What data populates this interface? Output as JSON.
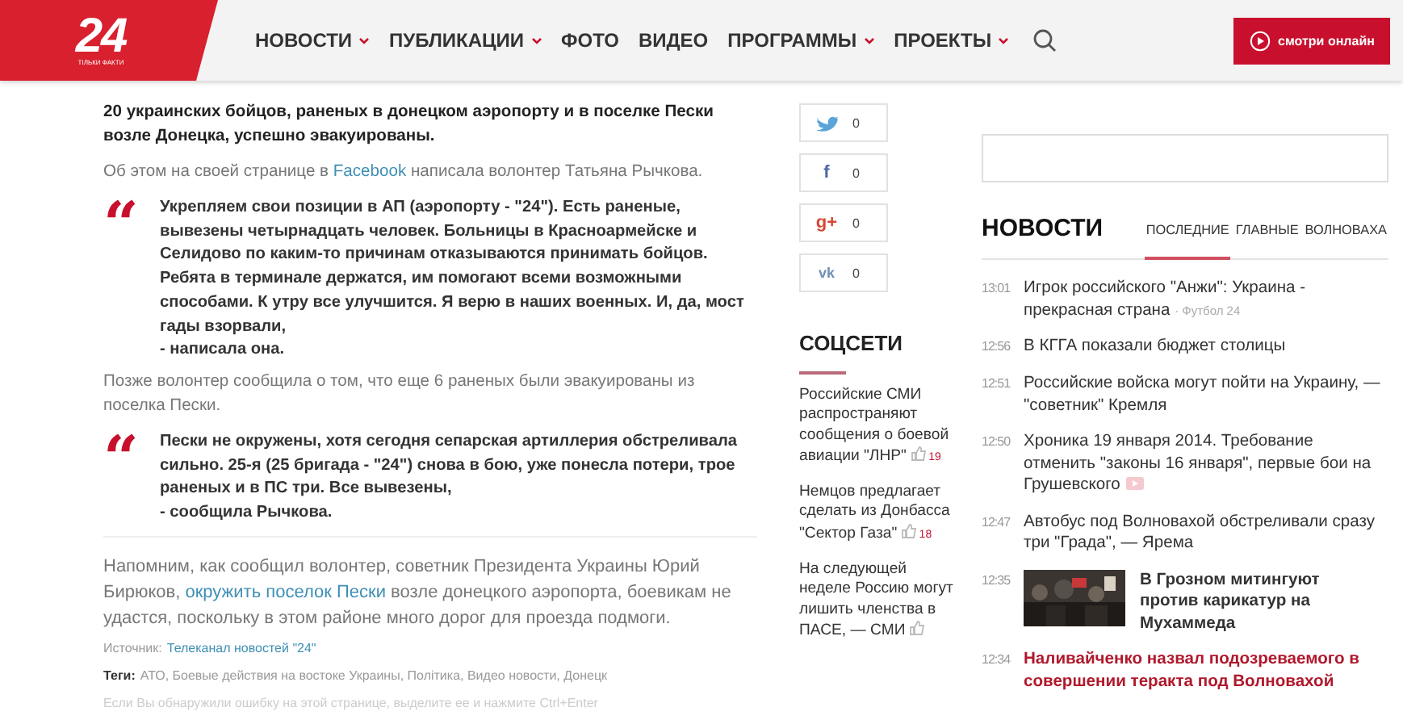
{
  "header": {
    "logo": {
      "number": "24",
      "tagline": "ТІЛЬКИ ФАКТИ"
    },
    "nav": [
      {
        "label": "НОВОСТИ",
        "has_menu": true
      },
      {
        "label": "ПУБЛИКАЦИИ",
        "has_menu": true
      },
      {
        "label": "ФОТО",
        "has_menu": false
      },
      {
        "label": "ВИДЕО",
        "has_menu": false
      },
      {
        "label": "ПРОГРАММЫ",
        "has_menu": true
      },
      {
        "label": "ПРОЕКТЫ",
        "has_menu": true
      }
    ],
    "live_button": "смотри онлайн"
  },
  "article": {
    "blocks": [
      {
        "kind": "lead",
        "text": "20 украинских бойцов, раненых в донецком аэропорту и в поселке Пески возле Донецка, успешно эвакуированы."
      },
      {
        "kind": "paragraph",
        "text": "Об этом на своей странице в ",
        "link": "Facebook",
        "after": " написала волонтер Татьяна Рычкова."
      },
      {
        "kind": "quote",
        "mark": "“",
        "lines": [
          "Укрепляем свои позиции в АП (аэропорту - \"24\"). Есть раненые, вывезены четырнадцать человек. Больницы в Красноармейске и Селидово по каким-то причинам отказываются принимать бойцов. Ребята в терминале держатся, им помогают всеми возможными способами. К утру все улучшится. Я верю в наших военных. И, да, мост гады взорвали,",
          "- написала она."
        ]
      },
      {
        "kind": "paragraph",
        "text": "Позже волонтер сообщила о том, что еще 6 раненых были эвакуированы из поселка Пески."
      },
      {
        "kind": "quote",
        "mark": "“",
        "lines": [
          "Пески не окружены, хотя сегодня сепарская артиллерия обстреливала сильно. 25-я (25 бригада - \"24\") снова в бою, уже понесла потери, трое раненых и в ПС три. Все вывезены,",
          "- сообщила Рычкова."
        ]
      },
      {
        "kind": "large",
        "text": "Напомним, как сообщил волонтер, советник Президента Украины Юрий Бирюков, ",
        "link": "окружить поселок Пески",
        "after": " возле донецкого аэропорта, боевикам не удастся, поскольку в этом районе много дорог для проезда подмоги."
      }
    ],
    "source": {
      "label": "Источник:",
      "link": "Телеканал новостей \"24\""
    },
    "tags": {
      "label": "Теги:",
      "text": "АТО, Боевые действия на востоке Украины, Політика, Видео новости, Донецк"
    },
    "error_note": "Если Вы обнаружили ошибку на этой странице, выделите ее и нажмите Ctrl+Enter"
  },
  "share": [
    {
      "kind": "twitter",
      "count": "0"
    },
    {
      "kind": "facebook",
      "glyph": "f",
      "count": "0"
    },
    {
      "kind": "google",
      "glyph": "g+",
      "count": "0"
    },
    {
      "kind": "vk",
      "glyph": "vk",
      "count": "0"
    }
  ],
  "social": {
    "title": "СОЦСЕТИ",
    "items": [
      {
        "text": "Российские СМИ распространяют сообщения о боевой авиации \"ЛНР\"",
        "likes": "19"
      },
      {
        "text": "Немцов предлагает сделать из Донбасса \"Сектор Газа\"",
        "likes": "18"
      },
      {
        "text": "На следующей неделе Россию могут лишить членства в ПАСЕ, — СМИ"
      }
    ]
  },
  "news": {
    "title": "НОВОСТИ",
    "tabs": [
      {
        "label": "ПОСЛЕДНИЕ",
        "selected": true
      },
      {
        "label": "ГЛАВНЫЕ",
        "selected": false
      },
      {
        "label": "ВОЛНОВАХА",
        "selected": false
      }
    ],
    "items": [
      {
        "time": "13:01",
        "kind": "normal",
        "text": "Игрок российского \"Анжи\": Украина - прекрасная страна",
        "source": "· Футбол 24"
      },
      {
        "time": "12:56",
        "kind": "normal",
        "text": "В КГГА показали бюджет столицы"
      },
      {
        "time": "12:51",
        "kind": "normal",
        "text": "Российские войска могут пойти на Украину, — \"советник\" Кремля"
      },
      {
        "time": "12:50",
        "kind": "video",
        "text": "Хроника 19 января 2014. Требование отменить \"законы 16 января\", первые бои на Грушевского"
      },
      {
        "time": "12:47",
        "kind": "normal",
        "text": "Автобус под Волновахой обстреливали сразу три \"Града\", — Ярема"
      },
      {
        "time": "12:35",
        "text": "В Грозном митингуют против карикатур на Мухаммеда"
      },
      {
        "time": "12:34",
        "kind": "highlight",
        "text": "Наливайченко назвал подозреваемого в совершении теракта под Волновахой"
      }
    ]
  }
}
